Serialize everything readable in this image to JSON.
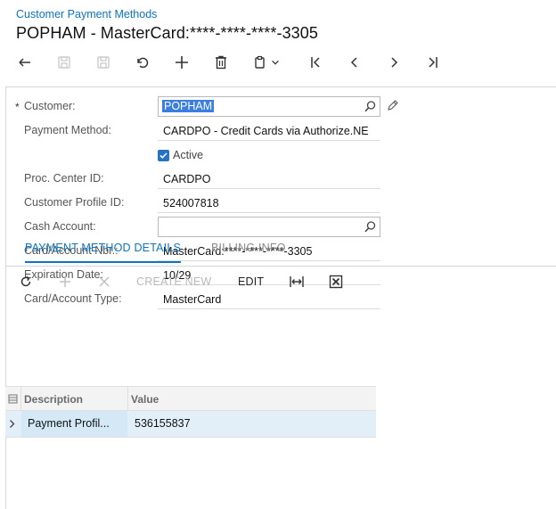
{
  "header": {
    "breadcrumb": "Customer Payment Methods",
    "title": "POPHAM - MasterCard:****-****-****-3305"
  },
  "toolbar": {
    "buttons": [
      {
        "name": "back-icon"
      },
      {
        "name": "save-icon"
      },
      {
        "name": "save-close-icon"
      },
      {
        "name": "undo-icon"
      },
      {
        "name": "add-icon"
      },
      {
        "name": "delete-icon"
      },
      {
        "name": "copy-paste-icon"
      },
      {
        "name": "first-record-icon"
      },
      {
        "name": "previous-record-icon"
      },
      {
        "name": "next-record-icon"
      },
      {
        "name": "last-record-icon"
      }
    ]
  },
  "form": {
    "customer_label": "Customer:",
    "customer_required_mark": "*",
    "customer_value": "POPHAM",
    "payment_method_label": "Payment Method:",
    "payment_method_value": "CARDPO - Credit Cards via Authorize.NE",
    "active_label": "Active",
    "active_checked": true,
    "proc_center_label": "Proc. Center ID:",
    "proc_center_value": "CARDPO",
    "customer_profile_label": "Customer Profile ID:",
    "customer_profile_value": "524007818",
    "cash_account_label": "Cash Account:",
    "cash_account_value": "",
    "card_account_nbr_label": "Card/Account Nbr.:",
    "card_account_nbr_value": "MasterCard:****-****-****-3305",
    "expiration_label": "Expiration Date:",
    "expiration_value": "10/29",
    "card_type_label": "Card/Account Type:",
    "card_type_value": "MasterCard"
  },
  "tabs": [
    {
      "label": "PAYMENT METHOD DETAILS",
      "active": true
    },
    {
      "label": "BILLING INFO",
      "active": false
    }
  ],
  "grid_toolbar": {
    "create_new": "CREATE NEW",
    "edit": "EDIT"
  },
  "grid": {
    "columns": [
      "Description",
      "Value"
    ],
    "rows": [
      {
        "description": "Payment Profil...",
        "value": "536155837"
      }
    ]
  },
  "colors": {
    "accent": "#0b74c4",
    "selection": "#3b7ee1",
    "row_highlight": "#e3eff8"
  }
}
